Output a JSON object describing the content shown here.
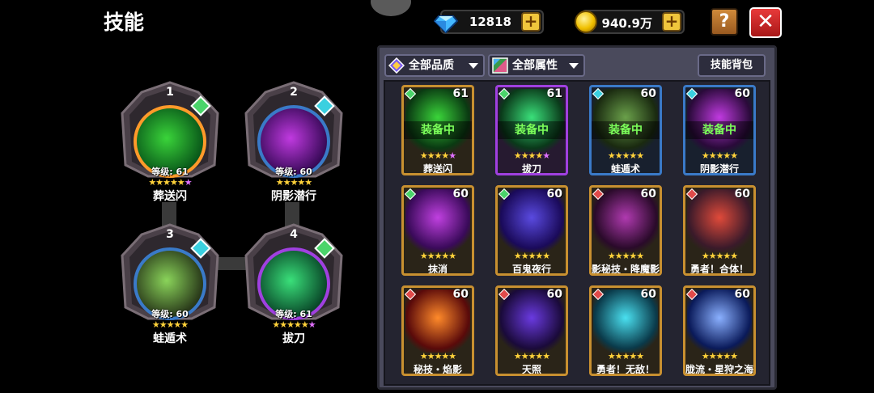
{
  "title": "技能",
  "currency": {
    "gems": "12818",
    "gold": "940.9万"
  },
  "icons": {
    "plus": "+",
    "help": "?",
    "close": "✕"
  },
  "slots": [
    {
      "num": "1",
      "level": "等级: 61",
      "name": "葬送闪",
      "stars": "★★★★★",
      "purple_star": "★",
      "ring_color": "#ff9a2a",
      "diamond_color": "#4ad46a"
    },
    {
      "num": "2",
      "level": "等级: 60",
      "name": "阴影潜行",
      "stars": "★★★★★",
      "purple_star": "",
      "ring_color": "#3a7ac8",
      "diamond_color": "#3ad0e0"
    },
    {
      "num": "3",
      "level": "等级: 60",
      "name": "蛙遁术",
      "stars": "★★★★★",
      "purple_star": "",
      "ring_color": "#3a7ac8",
      "diamond_color": "#3ad0e0"
    },
    {
      "num": "4",
      "level": "等级: 61",
      "name": "拔刀",
      "stars": "★★★★★",
      "purple_star": "★",
      "ring_color": "#a040e0",
      "diamond_color": "#4ad46a"
    }
  ],
  "filters": {
    "quality": "全部品质",
    "attribute": "全部属性",
    "bag": "技能背包"
  },
  "equipped_label": "装备中",
  "skills": [
    {
      "name": "葬送闪",
      "level": "61",
      "stars": "★★★★",
      "purple": "★",
      "equipped": true,
      "frame": "gold",
      "gem": "#4ad46a"
    },
    {
      "name": "拔刀",
      "level": "61",
      "stars": "★★★★",
      "purple": "★",
      "equipped": true,
      "frame": "purple",
      "gem": "#4ad46a"
    },
    {
      "name": "蛙遁术",
      "level": "60",
      "stars": "★★★★★",
      "purple": "",
      "equipped": true,
      "frame": "blue",
      "gem": "#3ad0e0"
    },
    {
      "name": "阴影潜行",
      "level": "60",
      "stars": "★★★★★",
      "purple": "",
      "equipped": true,
      "frame": "blue",
      "gem": "#3ad0e0"
    },
    {
      "name": "抹消",
      "level": "60",
      "stars": "★★★★★",
      "purple": "",
      "equipped": false,
      "frame": "gold",
      "gem": "#4ad46a"
    },
    {
      "name": "百鬼夜行",
      "level": "60",
      "stars": "★★★★★",
      "purple": "",
      "equipped": false,
      "frame": "gold",
      "gem": "#4ad46a"
    },
    {
      "name": "影秘技・降魔影",
      "level": "60",
      "stars": "★★★★★",
      "purple": "",
      "equipped": false,
      "frame": "gold",
      "gem": "#e04a4a"
    },
    {
      "name": "勇者！合体！",
      "level": "60",
      "stars": "★★★★★",
      "purple": "",
      "equipped": false,
      "frame": "gold",
      "gem": "#e04a4a"
    },
    {
      "name": "秘技・焰影",
      "level": "60",
      "stars": "★★★★★",
      "purple": "",
      "equipped": false,
      "frame": "gold",
      "gem": "#e04a4a"
    },
    {
      "name": "天照",
      "level": "60",
      "stars": "★★★★★",
      "purple": "",
      "equipped": false,
      "frame": "gold",
      "gem": "#e04a4a"
    },
    {
      "name": "勇者！无敌！",
      "level": "60",
      "stars": "★★★★★",
      "purple": "",
      "equipped": false,
      "frame": "gold",
      "gem": "#e04a4a"
    },
    {
      "name": "胧流・星狩之海",
      "level": "60",
      "stars": "★★★★★",
      "purple": "",
      "equipped": false,
      "frame": "gold",
      "gem": "#e04a4a"
    }
  ]
}
